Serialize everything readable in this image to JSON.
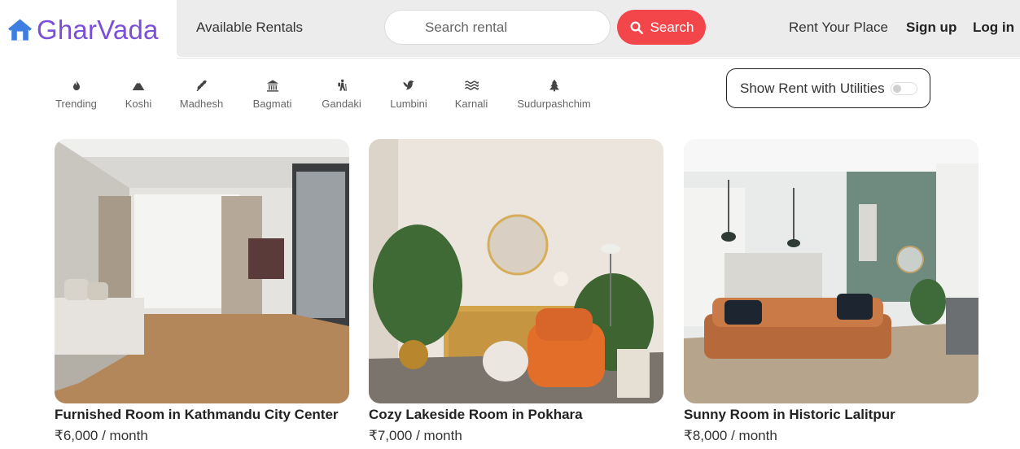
{
  "brand": {
    "name": "GharVada",
    "color": "#7b4fd6",
    "icon": "house-icon"
  },
  "nav": {
    "available_rentals": "Available Rentals",
    "search_placeholder": "Search rental",
    "search_button": "Search",
    "rent_your_place": "Rent Your Place",
    "sign_up": "Sign up",
    "log_in": "Log in"
  },
  "categories": [
    {
      "label": "Trending",
      "icon": "fire-icon"
    },
    {
      "label": "Koshi",
      "icon": "mountain-icon"
    },
    {
      "label": "Madhesh",
      "icon": "wheat-icon"
    },
    {
      "label": "Bagmati",
      "icon": "temple-icon"
    },
    {
      "label": "Gandaki",
      "icon": "hiker-icon"
    },
    {
      "label": "Lumbini",
      "icon": "dove-icon"
    },
    {
      "label": "Karnali",
      "icon": "water-icon"
    },
    {
      "label": "Sudurpashchim",
      "icon": "tree-icon"
    }
  ],
  "utilities_toggle": {
    "label": "Show Rent with Utilities",
    "on": false
  },
  "listings": [
    {
      "title": "Furnished Room in Kathmandu City Center",
      "price": "₹6,000 / month"
    },
    {
      "title": "Cozy Lakeside Room in Pokhara",
      "price": "₹7,000 / month"
    },
    {
      "title": "Sunny Room in Historic Lalitpur",
      "price": "₹8,000 / month"
    }
  ],
  "colors": {
    "accent": "#f2464b",
    "brand": "#7b4fd6",
    "nav_bg": "#ececec"
  }
}
